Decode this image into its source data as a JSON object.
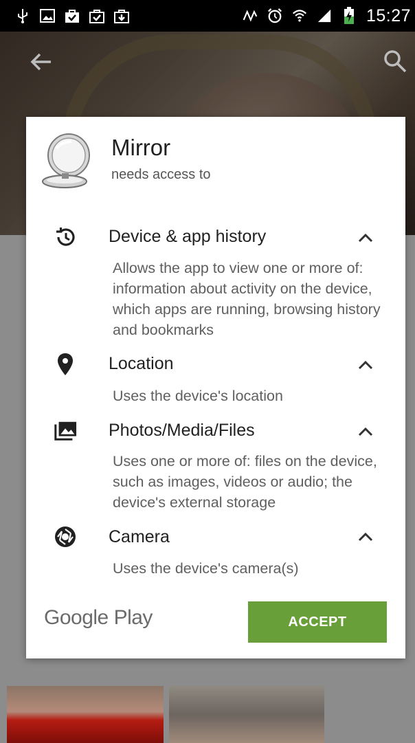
{
  "status_bar": {
    "time": "15:27",
    "left_icons": [
      "usb-icon",
      "image-icon",
      "shopping-bag-check-icon",
      "shopping-bag-check-icon",
      "shopping-bag-download-icon"
    ],
    "right_icons": [
      "nfc-icon",
      "alarm-icon",
      "wifi-icon",
      "signal-icon",
      "battery-charging-icon"
    ]
  },
  "dialog": {
    "app_name": "Mirror",
    "subtitle": "needs access to",
    "permissions": [
      {
        "icon": "history-icon",
        "title": "Device & app history",
        "description": "Allows the app to view one or more of: information about activity on the device, which apps are running, browsing history and bookmarks"
      },
      {
        "icon": "location-pin-icon",
        "title": "Location",
        "description": "Uses the device's location"
      },
      {
        "icon": "photos-media-icon",
        "title": "Photos/Media/Files",
        "description": "Uses one or more of: files on the device, such as images, videos or audio; the device's external storage"
      },
      {
        "icon": "camera-shutter-icon",
        "title": "Camera",
        "description": "Uses the device's camera(s)"
      }
    ],
    "footer_logo": "Google Play",
    "accept_label": "ACCEPT",
    "accent_color": "#689f38"
  }
}
